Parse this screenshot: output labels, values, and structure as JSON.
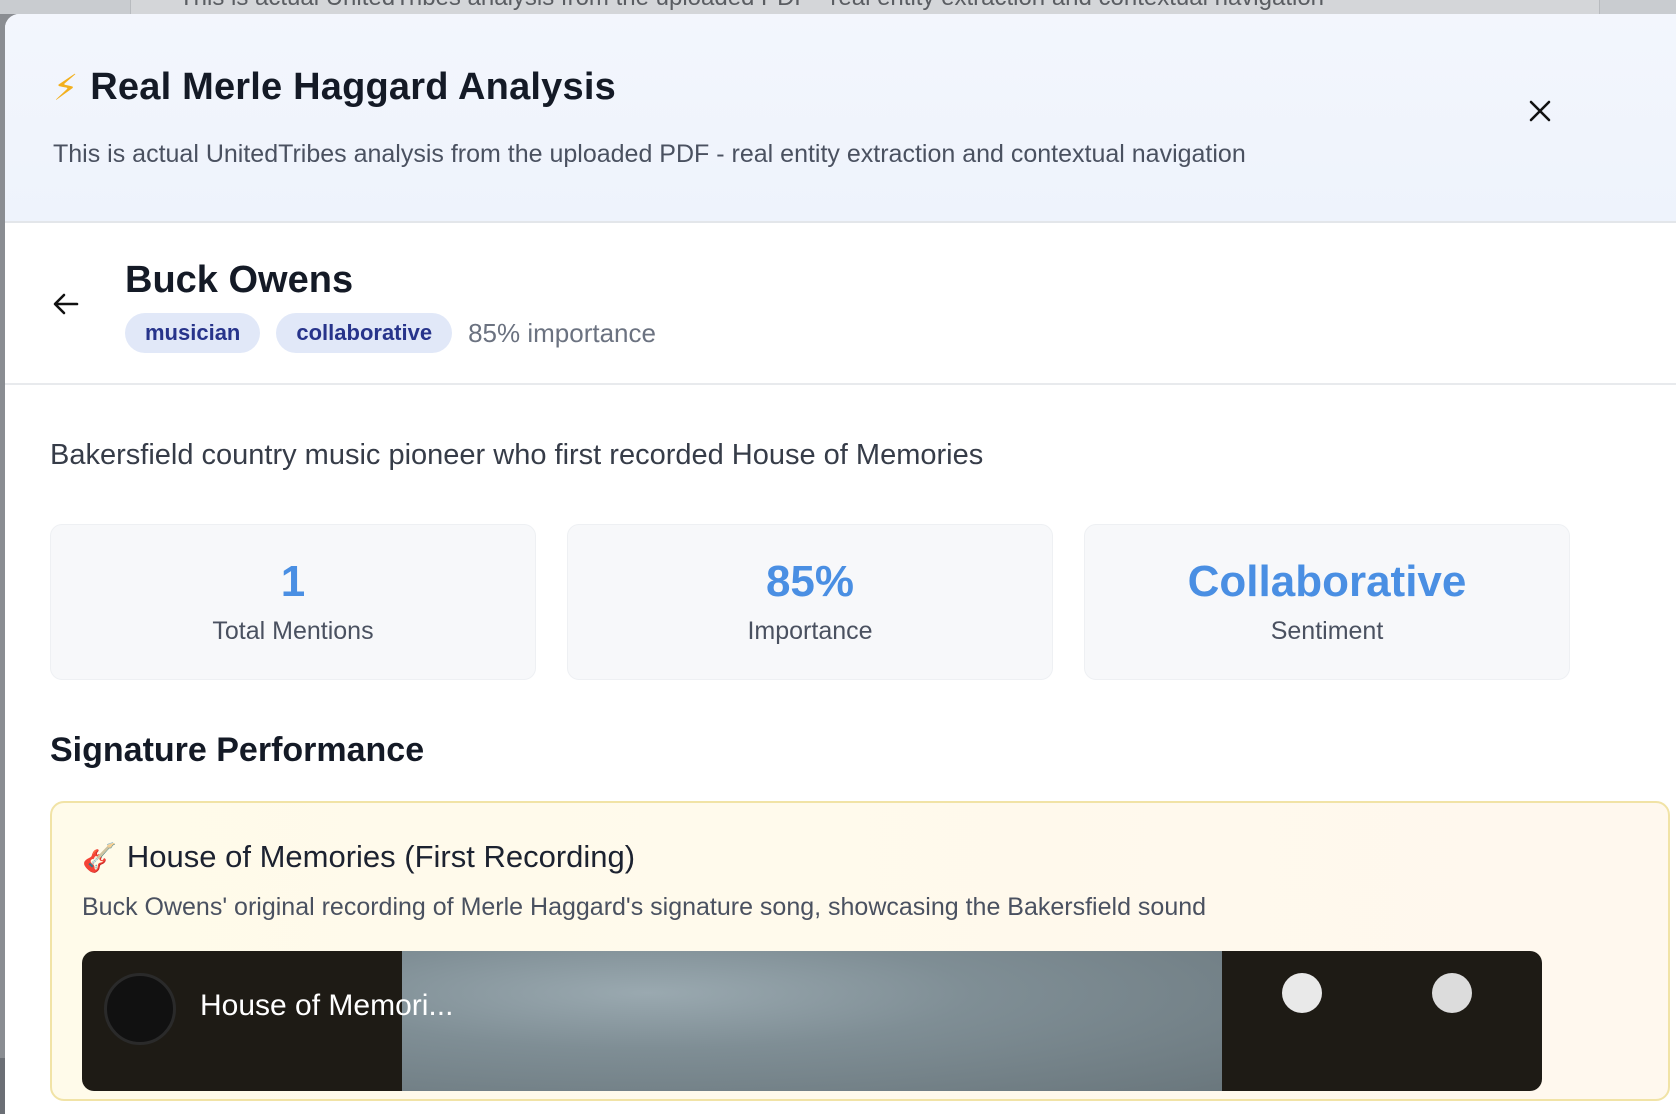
{
  "background": {
    "text": "This is actual UnitedTribes analysis from the uploaded PDF - real entity extraction and contextual navigation"
  },
  "modal": {
    "icon": "lightning-bolt-icon",
    "title": "Real Merle Haggard Analysis",
    "subtitle": "This is actual UnitedTribes analysis from the uploaded PDF - real entity extraction and contextual navigation",
    "close_icon": "close-icon"
  },
  "entity": {
    "name": "Buck Owens",
    "tags": [
      "musician",
      "collaborative"
    ],
    "importance_text": "85% importance",
    "description": "Bakersfield country music pioneer who first recorded House of Memories"
  },
  "stats": [
    {
      "value": "1",
      "label": "Total Mentions"
    },
    {
      "value": "85%",
      "label": "Importance"
    },
    {
      "value": "Collaborative",
      "label": "Sentiment"
    }
  ],
  "signature": {
    "section_title": "Signature Performance",
    "title_icon": "guitar-icon",
    "title": "House of Memories (First Recording)",
    "description": "Buck Owens' original recording of Merle Haggard's signature song, showcasing the Bakersfield sound",
    "video_title": "House of Memori..."
  },
  "colors": {
    "accent": "#4a8fe3",
    "tag_bg": "#e1e8f8",
    "tag_text": "#27348b",
    "bolt": "#f2b01e"
  }
}
